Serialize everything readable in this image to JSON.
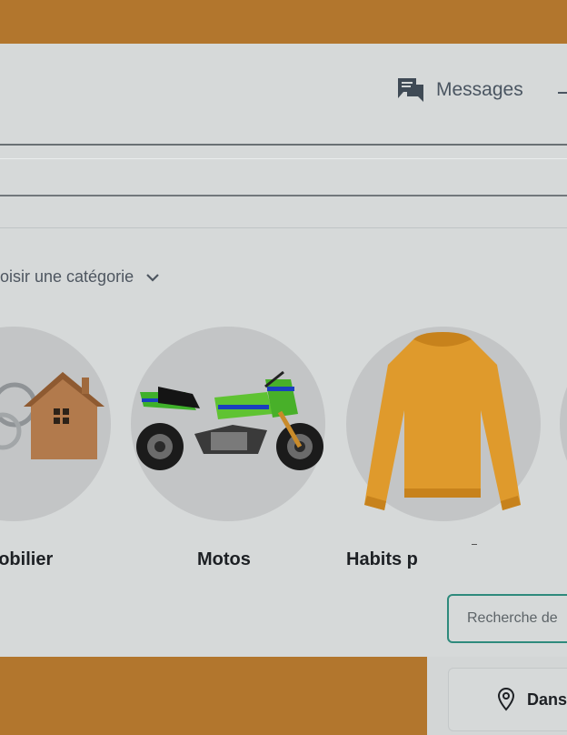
{
  "header": {
    "messages_label": "Messages"
  },
  "categories": {
    "select_label": "oisir une catégorie",
    "items": [
      {
        "label": "nobilier"
      },
      {
        "label": "Motos"
      },
      {
        "label": "Habits p"
      }
    ]
  },
  "search": {
    "placeholder": "Recherche de"
  },
  "location": {
    "label": "Dans"
  },
  "colors": {
    "background": "#b2762d",
    "accent": "#2e8a7c",
    "text": "#1d2024"
  }
}
